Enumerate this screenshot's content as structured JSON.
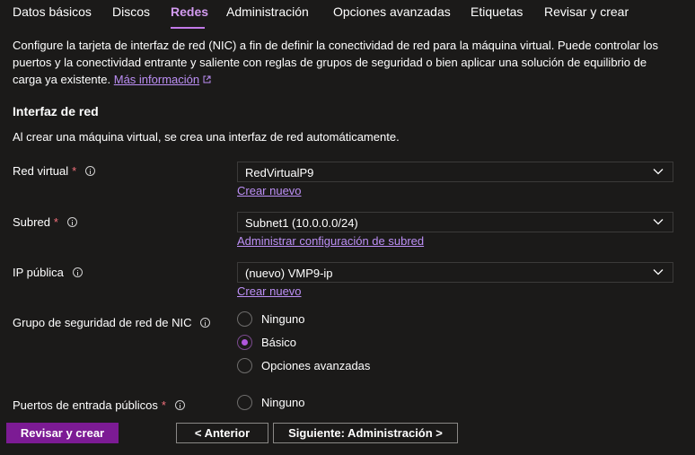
{
  "tabs": [
    {
      "label": "Datos básicos"
    },
    {
      "label": "Discos"
    },
    {
      "label": "Redes"
    },
    {
      "label": "Administración"
    },
    {
      "label": "Opciones avanzadas"
    },
    {
      "label": "Etiquetas"
    },
    {
      "label": "Revisar y crear"
    }
  ],
  "active_tab": "Redes",
  "description": {
    "text": "Configure la tarjeta de interfaz de red (NIC) a fin de definir la conectividad de red para la máquina virtual. Puede controlar los puertos y la conectividad entrante y saliente con reglas de grupos de seguridad o bien aplicar una solución de equilibrio de carga ya existente.",
    "link": "Más información"
  },
  "section": {
    "title": "Interfaz de red",
    "subtitle": "Al crear una máquina virtual, se crea una interfaz de red automáticamente."
  },
  "fields": {
    "vnet": {
      "label": "Red virtual",
      "required": "*",
      "value": "RedVirtualP9",
      "link": "Crear nuevo"
    },
    "subnet": {
      "label": "Subred",
      "required": "*",
      "value": "Subnet1 (10.0.0.0/24)",
      "link": "Administrar configuración de subred"
    },
    "public_ip": {
      "label": "IP pública",
      "value": "(nuevo) VMP9-ip",
      "link": "Crear nuevo"
    },
    "nsg": {
      "label": "Grupo de seguridad de red de NIC",
      "options": [
        "Ninguno",
        "Básico",
        "Opciones avanzadas"
      ],
      "selected": "Básico"
    },
    "ports": {
      "label": "Puertos de entrada públicos",
      "required": "*",
      "options": [
        "Ninguno"
      ]
    }
  },
  "footer": {
    "review_create": "Revisar y crear",
    "previous": "< Anterior",
    "next": "Siguiente: Administración >"
  },
  "colors": {
    "accent": "#7c1b94",
    "active_tab": "#d39bf0",
    "link": "#bc8ff5",
    "required": "#f1707b"
  }
}
